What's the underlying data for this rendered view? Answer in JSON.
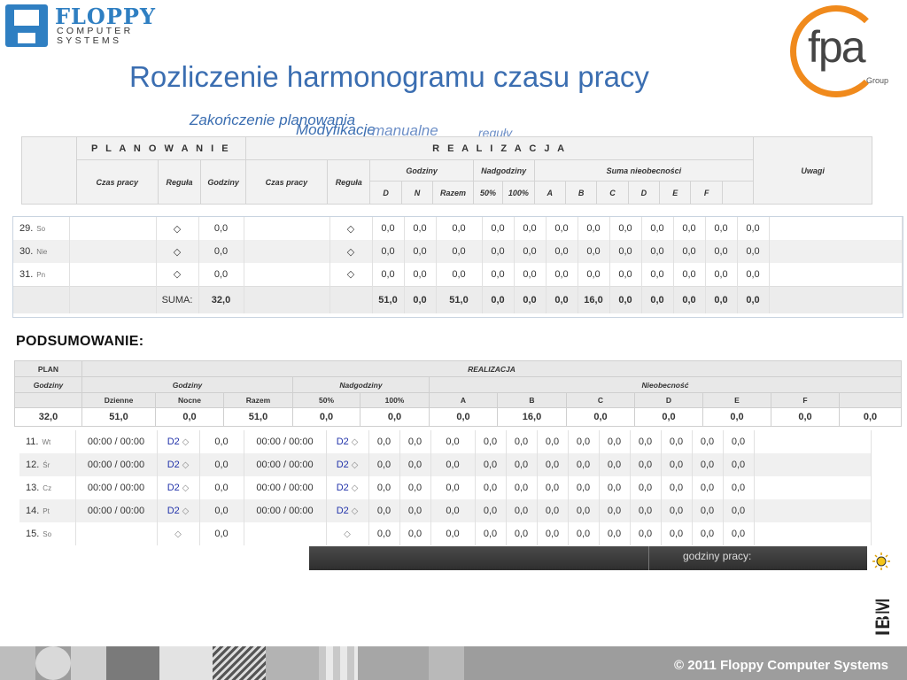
{
  "branding": {
    "floppy_word": "FLOPPY",
    "floppy_line1": "COMPUTER",
    "floppy_line2": "SYSTEMS",
    "fpa_word": "fpa",
    "fpa_group": "Group",
    "ibm_word": "IBM"
  },
  "title": "Rozliczenie harmonogramu czasu pracy",
  "overlays": {
    "o1": "Zakończenie planowania",
    "o2": "Modyfikacje",
    "o3": "manualne",
    "o4": "reguły"
  },
  "header": {
    "planowanie": "P L A N O W A N I E",
    "realizacja": "R E A L I Z A C J A",
    "uwagi": "Uwagi",
    "czas_pracy": "Czas pracy",
    "regula": "Reguła",
    "godziny": "Godziny",
    "czas_pracy2": "Czas pracy",
    "regula2": "Reguła",
    "godziny2": "Godziny",
    "nadgodziny": "Nadgodziny",
    "suma_nieob": "Suma nieobecności",
    "d": "D",
    "n": "N",
    "razem": "Razem",
    "p50": "50%",
    "p100": "100%",
    "a": "A",
    "b": "B",
    "c": "C",
    "dd": "D",
    "e": "E",
    "f": "F"
  },
  "days1": [
    {
      "num": "29.",
      "wd": "So",
      "plan": "0,0",
      "vals": [
        "0,0",
        "0,0",
        "0,0",
        "0,0",
        "0,0",
        "0,0",
        "0,0",
        "0,0",
        "0,0",
        "0,0",
        "0,0",
        "0,0"
      ]
    },
    {
      "num": "30.",
      "wd": "Nie",
      "plan": "0,0",
      "vals": [
        "0,0",
        "0,0",
        "0,0",
        "0,0",
        "0,0",
        "0,0",
        "0,0",
        "0,0",
        "0,0",
        "0,0",
        "0,0",
        "0,0"
      ]
    },
    {
      "num": "31.",
      "wd": "Pn",
      "plan": "0,0",
      "vals": [
        "0,0",
        "0,0",
        "0,0",
        "0,0",
        "0,0",
        "0,0",
        "0,0",
        "0,0",
        "0,0",
        "0,0",
        "0,0",
        "0,0"
      ]
    }
  ],
  "suma": {
    "label": "SUMA:",
    "plan": "32,0",
    "vals": [
      "51,0",
      "0,0",
      "51,0",
      "0,0",
      "0,0",
      "0,0",
      "16,0",
      "0,0",
      "0,0",
      "0,0",
      "0,0",
      "0,0"
    ]
  },
  "podsumowanie": {
    "title": "PODSUMOWANIE:",
    "plan": "PLAN",
    "realizacja": "REALIZACJA",
    "godziny": "Godziny",
    "godziny2": "Godziny",
    "nadgodziny": "Nadgodziny",
    "nieobecnosc": "Nieobecność",
    "dzienne": "Dzienne",
    "nocne": "Nocne",
    "razem": "Razem",
    "p50": "50%",
    "p100": "100%",
    "a": "A",
    "b": "B",
    "c": "C",
    "d": "D",
    "e": "E",
    "f": "F",
    "values": [
      "32,0",
      "51,0",
      "0,0",
      "51,0",
      "0,0",
      "0,0",
      "0,0",
      "16,0",
      "0,0",
      "0,0",
      "0,0",
      "0,0",
      "0,0"
    ]
  },
  "days2": [
    {
      "num": "11.",
      "wd": "Wt",
      "czas": "00:00 / 00:00",
      "reg": "D2",
      "plan": "0,0",
      "czas2": "00:00 / 00:00",
      "reg2": "D2",
      "vals": [
        "0,0",
        "0,0",
        "0,0",
        "0,0",
        "0,0",
        "0,0",
        "0,0",
        "0,0",
        "0,0",
        "0,0",
        "0,0",
        "0,0"
      ]
    },
    {
      "num": "12.",
      "wd": "Śr",
      "czas": "00:00 / 00:00",
      "reg": "D2",
      "plan": "0,0",
      "czas2": "00:00 / 00:00",
      "reg2": "D2",
      "vals": [
        "0,0",
        "0,0",
        "0,0",
        "0,0",
        "0,0",
        "0,0",
        "0,0",
        "0,0",
        "0,0",
        "0,0",
        "0,0",
        "0,0"
      ]
    },
    {
      "num": "13.",
      "wd": "Cz",
      "czas": "00:00 / 00:00",
      "reg": "D2",
      "plan": "0,0",
      "czas2": "00:00 / 00:00",
      "reg2": "D2",
      "vals": [
        "0,0",
        "0,0",
        "0,0",
        "0,0",
        "0,0",
        "0,0",
        "0,0",
        "0,0",
        "0,0",
        "0,0",
        "0,0",
        "0,0"
      ]
    },
    {
      "num": "14.",
      "wd": "Pt",
      "czas": "00:00 / 00:00",
      "reg": "D2",
      "plan": "0,0",
      "czas2": "00:00 / 00:00",
      "reg2": "D2",
      "vals": [
        "0,0",
        "0,0",
        "0,0",
        "0,0",
        "0,0",
        "0,0",
        "0,0",
        "0,0",
        "0,0",
        "0,0",
        "0,0",
        "0,0"
      ]
    },
    {
      "num": "15.",
      "wd": "So",
      "czas": "",
      "reg": "",
      "plan": "0,0",
      "czas2": "",
      "reg2": "",
      "vals": [
        "0,0",
        "0,0",
        "0,0",
        "0,0",
        "0,0",
        "0,0",
        "0,0",
        "0,0",
        "0,0",
        "0,0",
        "0,0",
        "0,0"
      ]
    }
  ],
  "strip_text": "godziny pracy:",
  "footer_text": "© 2011 Floppy Computer Systems",
  "colors": {
    "title_blue": "#3b6eb1",
    "floppy_blue": "#2f7fc2",
    "fpa_orange": "#f08a1c",
    "footer_gray": "#9d9d9d"
  }
}
